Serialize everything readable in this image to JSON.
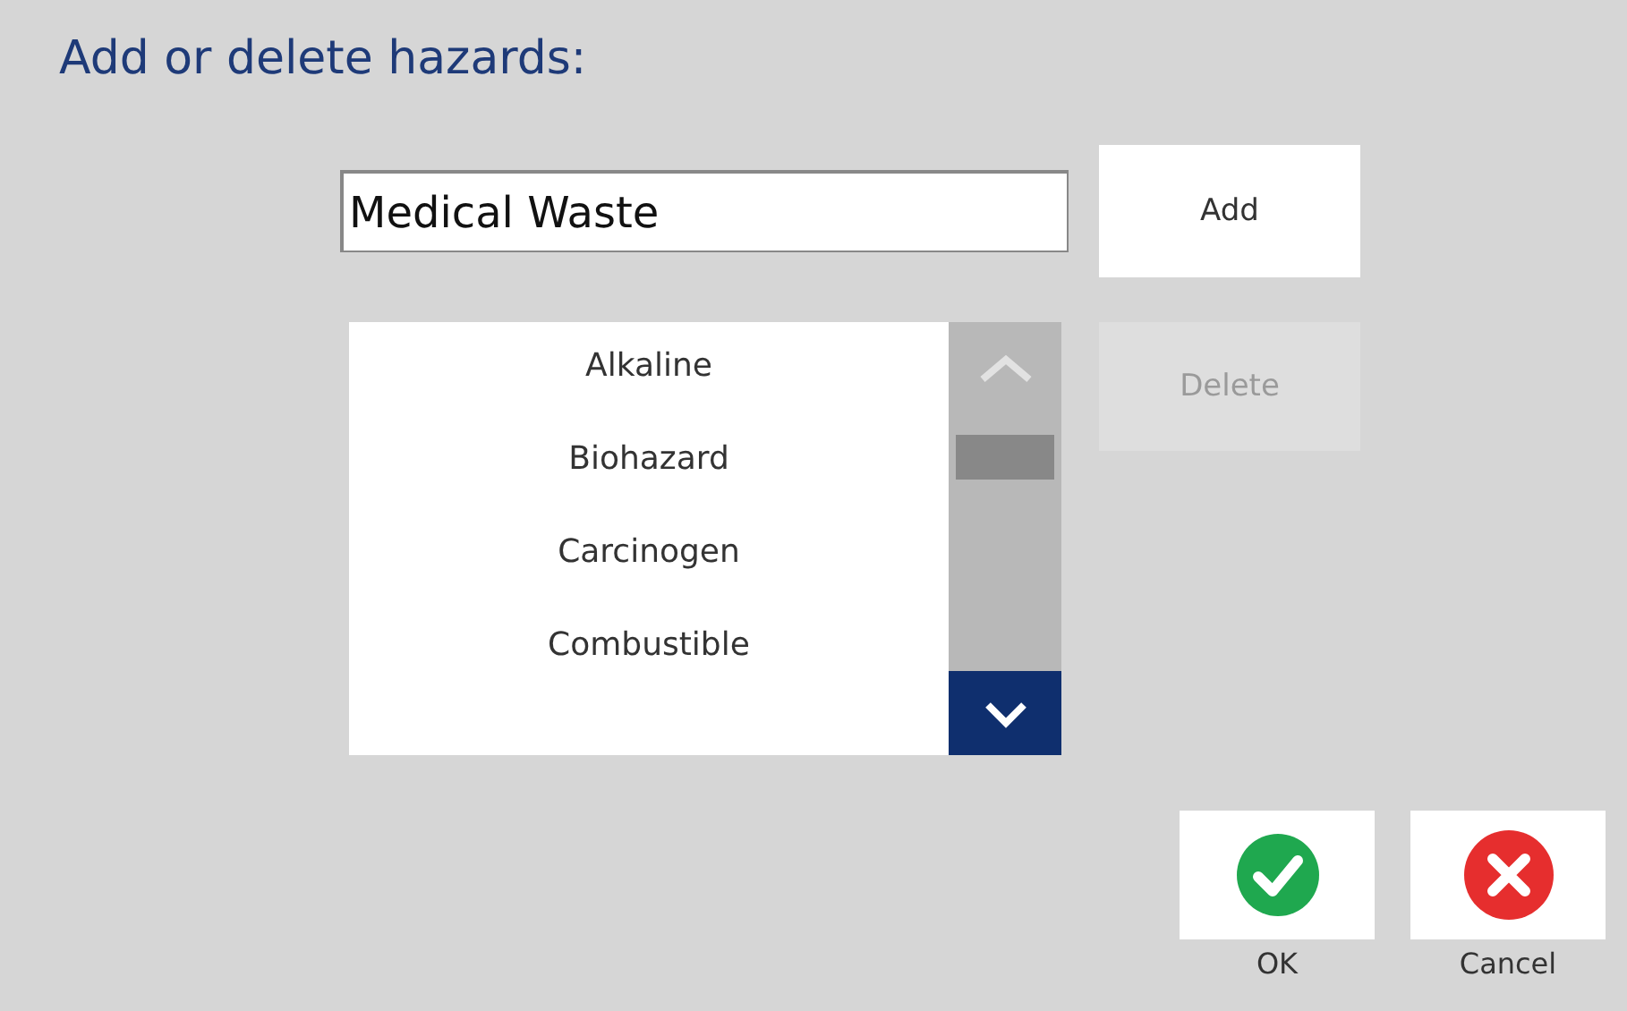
{
  "title": "Add or delete hazards:",
  "input": {
    "value": "Medical Waste"
  },
  "buttons": [
    {
      "kind": "add",
      "label": "Add",
      "disabled": false
    },
    {
      "kind": "delete",
      "label": "Delete",
      "disabled": true
    }
  ],
  "list": {
    "items": [
      {
        "label": "Alkaline"
      },
      {
        "label": "Biohazard"
      },
      {
        "label": "Carcinogen"
      },
      {
        "label": "Combustible"
      }
    ]
  },
  "dialog_buttons": [
    {
      "kind": "ok",
      "label": "OK"
    },
    {
      "kind": "cancel",
      "label": "Cancel"
    }
  ]
}
